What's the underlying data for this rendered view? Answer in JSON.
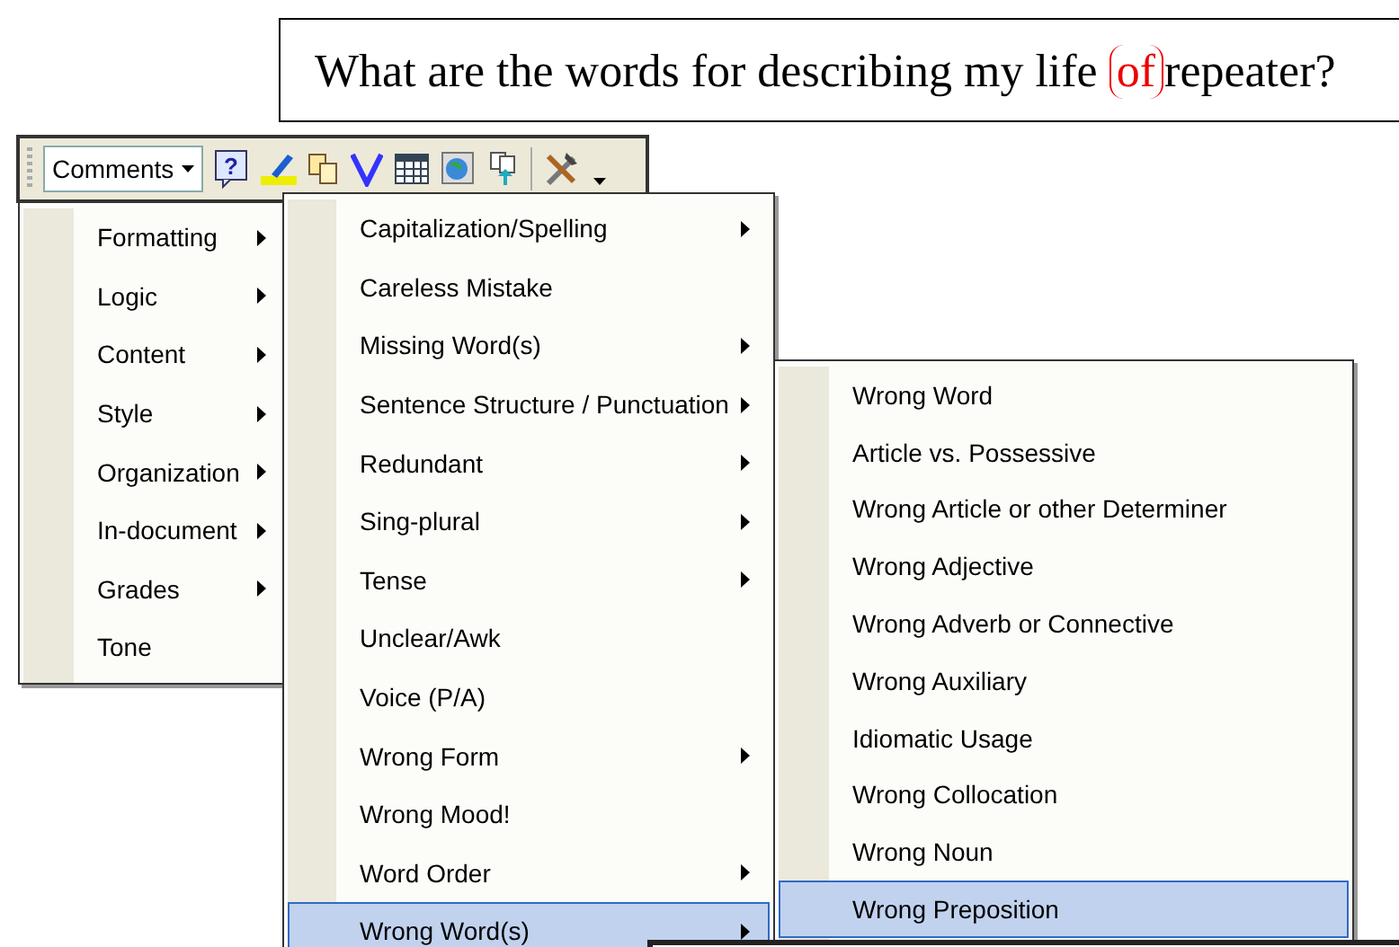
{
  "document": {
    "text_before": "What are the words for describing my life ",
    "marked": "of",
    "text_after": "repeater?"
  },
  "toolbar": {
    "dropdown": "Comments",
    "help_glyph": "?"
  },
  "menus": [
    {
      "items": [
        {
          "label": "Formatting",
          "submenu": true,
          "selected": false
        },
        {
          "label": "Logic",
          "submenu": true,
          "selected": false
        },
        {
          "label": "Content",
          "submenu": true,
          "selected": false
        },
        {
          "label": "Style",
          "submenu": true,
          "selected": false
        },
        {
          "label": "Organization",
          "submenu": true,
          "selected": false
        },
        {
          "label": "In-document",
          "submenu": true,
          "selected": false
        },
        {
          "label": "Grades",
          "submenu": true,
          "selected": false
        },
        {
          "label": "Tone",
          "submenu": false,
          "selected": false
        }
      ]
    },
    {
      "items": [
        {
          "label": "Capitalization/Spelling",
          "submenu": true,
          "selected": false
        },
        {
          "label": "Careless Mistake",
          "submenu": false,
          "selected": false
        },
        {
          "label": "Missing Word(s)",
          "submenu": true,
          "selected": false
        },
        {
          "label": "Sentence Structure / Punctuation",
          "submenu": true,
          "selected": false
        },
        {
          "label": "Redundant",
          "submenu": true,
          "selected": false
        },
        {
          "label": "Sing-plural",
          "submenu": true,
          "selected": false
        },
        {
          "label": "Tense",
          "submenu": true,
          "selected": false
        },
        {
          "label": "Unclear/Awk",
          "submenu": false,
          "selected": false
        },
        {
          "label": "Voice (P/A)",
          "submenu": false,
          "selected": false
        },
        {
          "label": "Wrong Form",
          "submenu": true,
          "selected": false
        },
        {
          "label": "Wrong Mood!",
          "submenu": false,
          "selected": false
        },
        {
          "label": "Word Order",
          "submenu": true,
          "selected": false
        },
        {
          "label": "Wrong Word(s)",
          "submenu": true,
          "selected": true
        }
      ]
    },
    {
      "items": [
        {
          "label": "Wrong Word",
          "submenu": false,
          "selected": false
        },
        {
          "label": "Article vs. Possessive",
          "submenu": false,
          "selected": false
        },
        {
          "label": "Wrong Article or other Determiner",
          "submenu": false,
          "selected": false
        },
        {
          "label": "Wrong Adjective",
          "submenu": false,
          "selected": false
        },
        {
          "label": "Wrong Adverb or Connective",
          "submenu": false,
          "selected": false
        },
        {
          "label": "Wrong Auxiliary",
          "submenu": false,
          "selected": false
        },
        {
          "label": "Idiomatic Usage",
          "submenu": false,
          "selected": false
        },
        {
          "label": "Wrong Collocation",
          "submenu": false,
          "selected": false
        },
        {
          "label": "Wrong Noun",
          "submenu": false,
          "selected": false
        },
        {
          "label": "Wrong Preposition",
          "submenu": false,
          "selected": true
        }
      ]
    }
  ]
}
